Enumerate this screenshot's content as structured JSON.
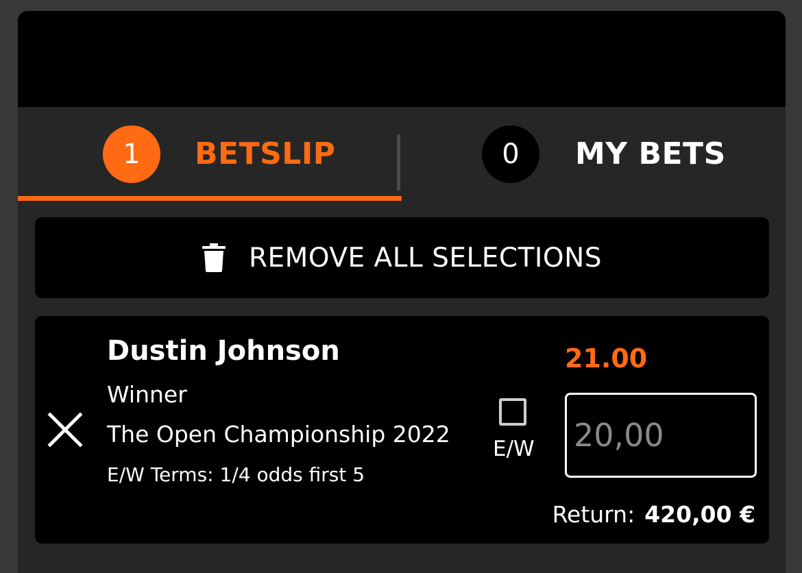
{
  "tabs": {
    "betslip": {
      "count": "1",
      "label": "BETSLIP"
    },
    "my_bets": {
      "count": "0",
      "label": "MY BETS"
    }
  },
  "remove_all": {
    "label": "REMOVE ALL SELECTIONS",
    "icon": "trash-icon"
  },
  "selection": {
    "name": "Dustin Johnson",
    "market": "Winner",
    "event": "The Open Championship 2022",
    "ew_terms": "E/W Terms: 1/4 odds first 5",
    "ew_label": "E/W",
    "ew_checked": false,
    "odds": "21.00",
    "stake_placeholder": "20,00",
    "return_label": "Return:",
    "return_value": "420,00 €"
  },
  "colors": {
    "accent": "#ff6a13",
    "background": "#383838",
    "panel": "#262626",
    "card": "#000000"
  }
}
